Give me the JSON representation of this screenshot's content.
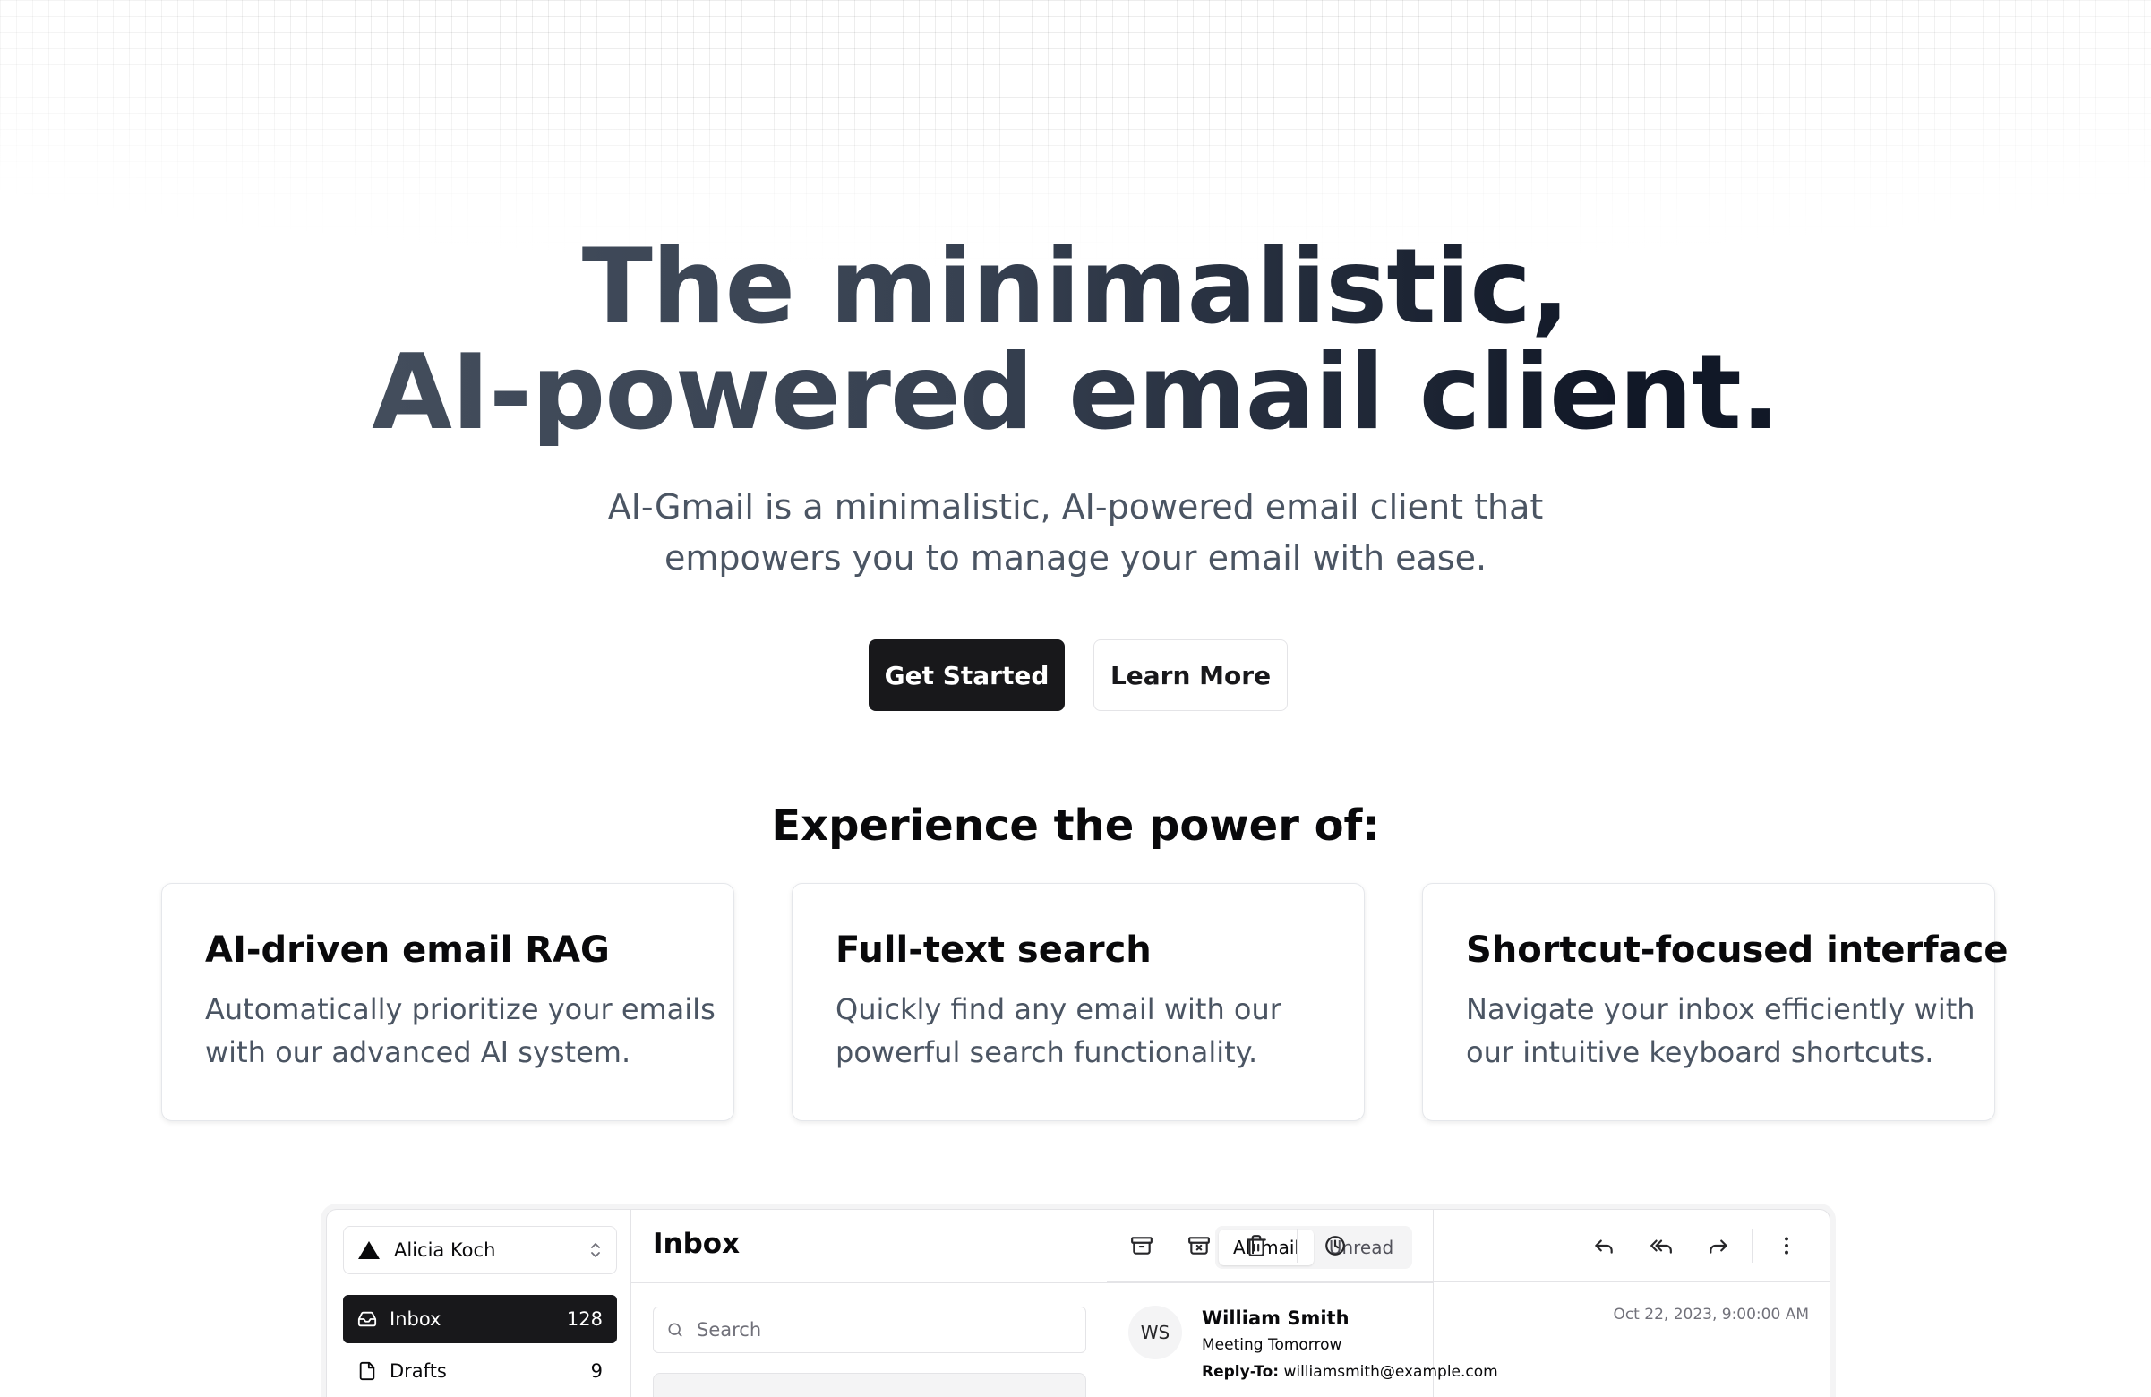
{
  "hero": {
    "title_line1": "The minimalistic,",
    "title_line2": "AI-powered email client.",
    "subtitle_line1": "AI-Gmail is a minimalistic, AI-powered email client that",
    "subtitle_line2": "empowers you to manage your email with ease.",
    "primary_button": "Get Started",
    "secondary_button": "Learn More"
  },
  "features": {
    "heading": "Experience the power of:",
    "cards": [
      {
        "title": "AI-driven email RAG",
        "desc_line1": "Automatically prioritize your emails",
        "desc_line2": "with our advanced AI system."
      },
      {
        "title": "Full-text search",
        "desc_line1": "Quickly find any email with our",
        "desc_line2": "powerful search functionality."
      },
      {
        "title": "Shortcut-focused interface",
        "desc_line1": "Navigate your inbox efficiently with",
        "desc_line2": "our intuitive keyboard shortcuts."
      }
    ]
  },
  "app_preview": {
    "account": {
      "name": "Alicia Koch",
      "icon": "triangle-logo-icon"
    },
    "nav": [
      {
        "label": "Inbox",
        "count": "128",
        "icon": "inbox-icon",
        "active": true
      },
      {
        "label": "Drafts",
        "count": "9",
        "icon": "file-icon",
        "active": false
      }
    ],
    "list": {
      "title": "Inbox",
      "tabs": [
        "All mail",
        "Unread"
      ],
      "selected_tab": "All mail",
      "search_placeholder": "Search"
    },
    "toolbar_icons": [
      "archive-icon",
      "archive-x-icon",
      "trash-icon",
      "clock-icon",
      "reply-icon",
      "reply-all-icon",
      "forward-icon",
      "more-vertical-icon"
    ],
    "message": {
      "initials": "WS",
      "from": "William Smith",
      "subject": "Meeting Tomorrow",
      "reply_to_label": "Reply-To:",
      "reply_to": "williamsmith@example.com",
      "date": "Oct 22, 2023, 9:00:00 AM"
    }
  },
  "colors": {
    "primary_button_bg": "#18181b",
    "border": "#e4e4e7",
    "muted_text": "#4b5563"
  }
}
